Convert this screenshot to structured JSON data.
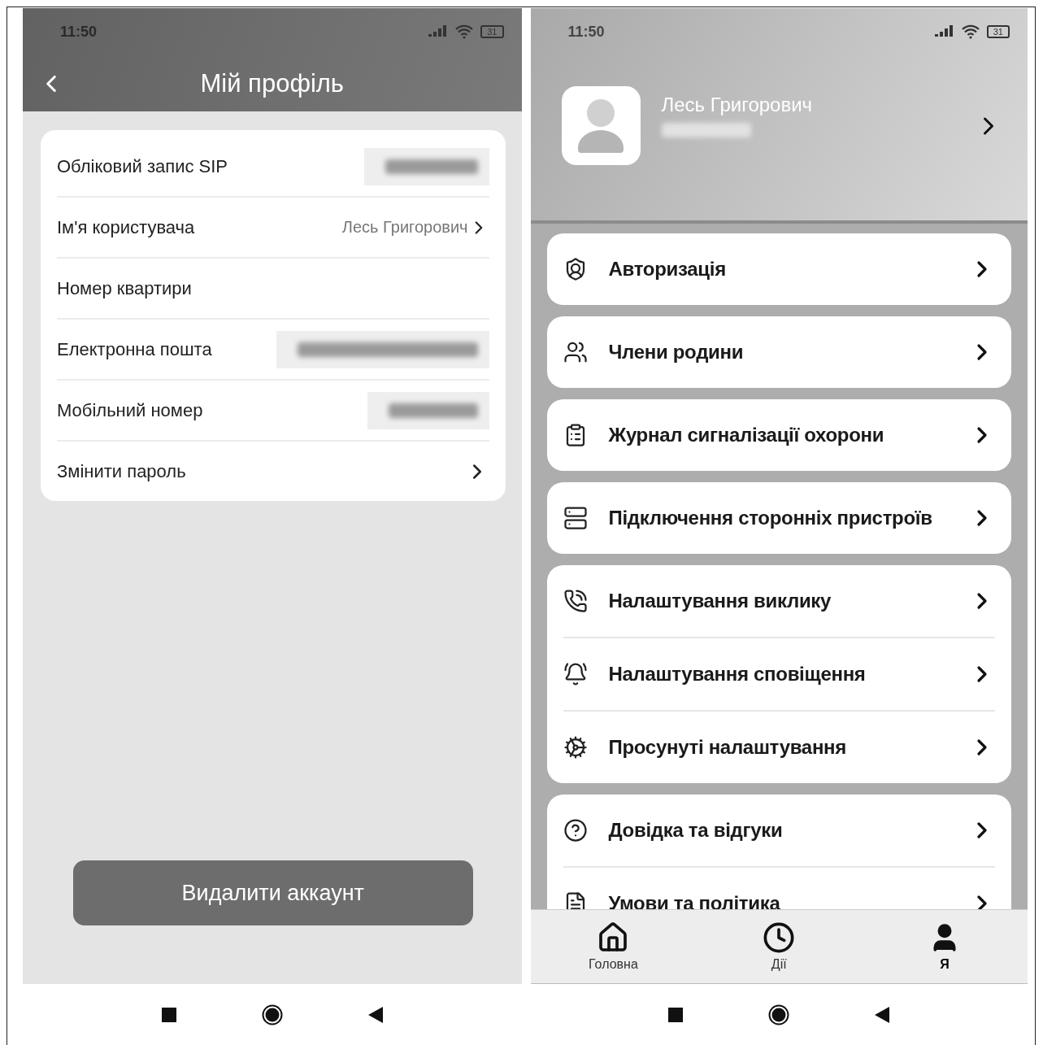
{
  "left_screen": {
    "status_bar": {
      "time": "11:50",
      "battery": "31"
    },
    "header": {
      "title": "Мій профіль"
    },
    "rows": [
      {
        "kind": "hidden",
        "label": "Обліковий запис SIP"
      },
      {
        "kind": "link",
        "label": "Ім'я користувача",
        "value": "Лесь Григорович"
      },
      {
        "kind": "plain",
        "label": "Номер квартири"
      },
      {
        "kind": "hidden",
        "label": "Електронна пошта"
      },
      {
        "kind": "hidden",
        "label": "Мобільний номер"
      },
      {
        "kind": "chevron",
        "label": "Змінити пароль"
      }
    ],
    "delete_button": "Видалити аккаунт"
  },
  "right_screen": {
    "status_bar": {
      "time": "11:50",
      "battery": "31"
    },
    "profile": {
      "name": "Лесь Григорович"
    },
    "menu_groups": [
      [
        {
          "label": "Авторизація"
        }
      ],
      [
        {
          "label": "Члени родини"
        }
      ],
      [
        {
          "label": "Журнал сигналізації охорони"
        }
      ],
      [
        {
          "label": "Підключення сторонніх пристроїв"
        }
      ],
      [
        {
          "label": "Налаштування виклику"
        },
        {
          "label": "Налаштування сповіщення"
        },
        {
          "label": "Просунуті налаштування"
        }
      ],
      [
        {
          "label": "Довідка та відгуки"
        },
        {
          "label": "Умови та політика"
        }
      ]
    ],
    "tab_bar": [
      {
        "label": "Головна",
        "selected": false
      },
      {
        "label": "Дії",
        "selected": false
      },
      {
        "label": "Я",
        "selected": true
      }
    ]
  }
}
